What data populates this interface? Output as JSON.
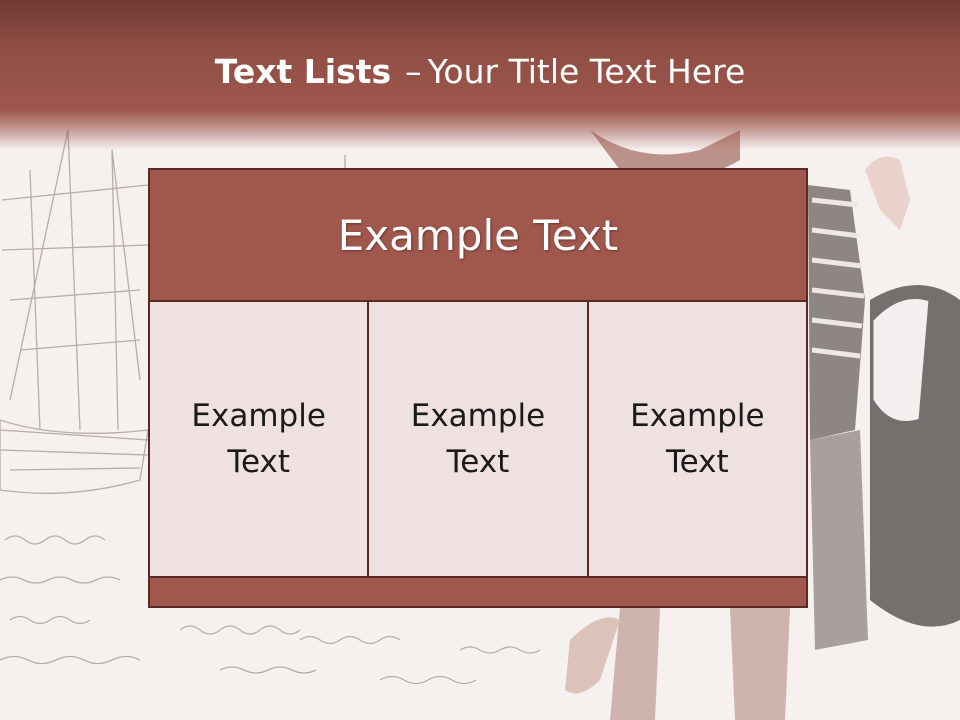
{
  "slide": {
    "title_bold": "Text Lists",
    "title_separator": "–",
    "title_rest": "Your Title Text Here"
  },
  "table": {
    "header": "Example Text",
    "cells": [
      "Example Text",
      "Example Text",
      "Example Text"
    ]
  },
  "colors": {
    "title_band": "#9e574d",
    "header_fill": "#a0574c",
    "cell_fill": "#eee0de",
    "border": "#5b2a25"
  },
  "background": {
    "description_icons": [
      "sailboat-sketch",
      "woman-with-shopping-bag"
    ]
  }
}
